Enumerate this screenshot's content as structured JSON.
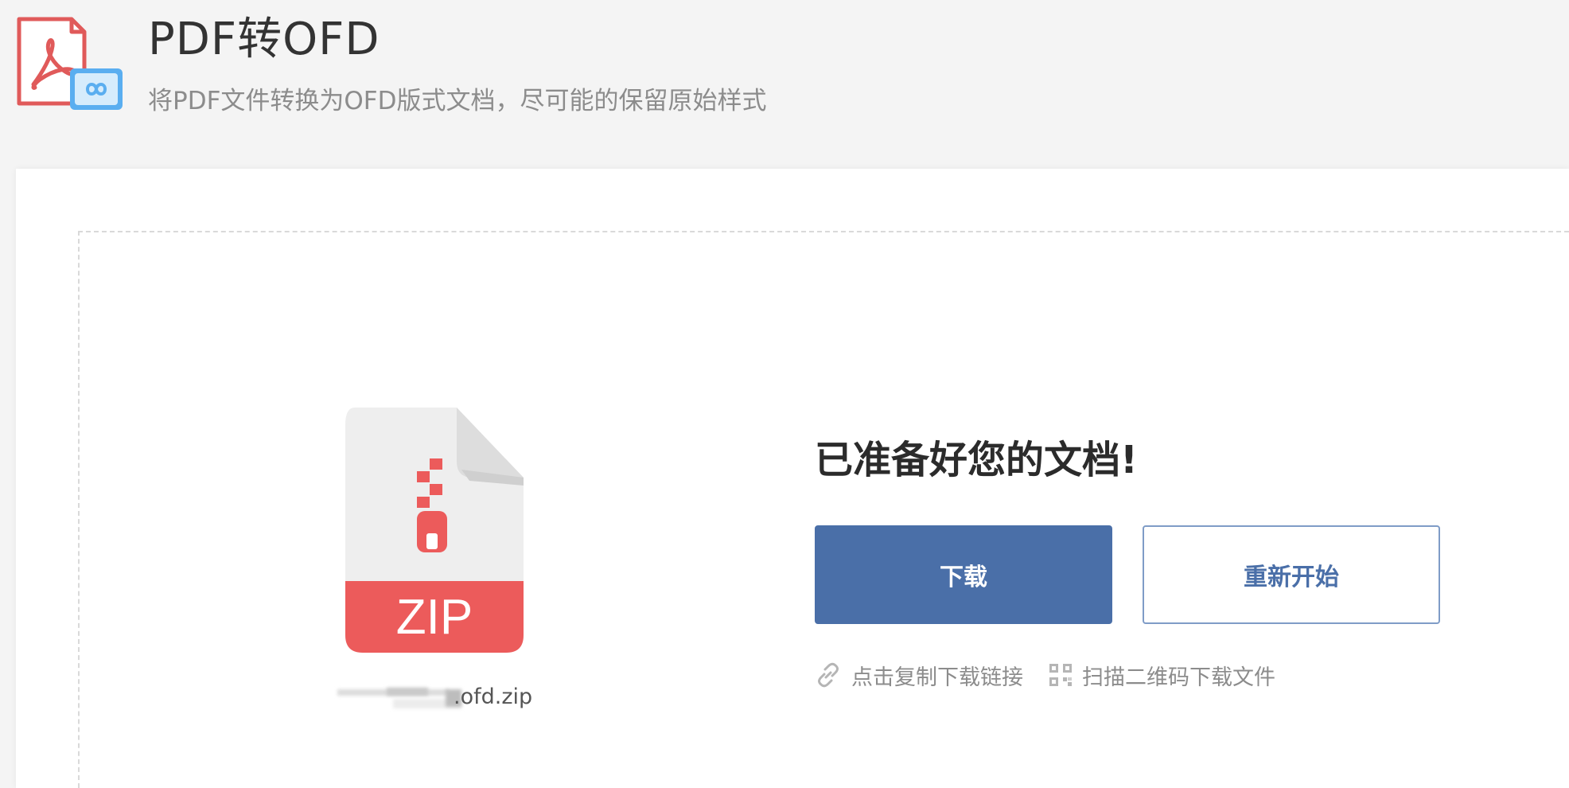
{
  "header": {
    "title": "PDF转OFD",
    "subtitle": "将PDF文件转换为OFD版式文档，尽可能的保留原始样式"
  },
  "logo": {
    "icon": "pdf-to-ofd-logo-icon",
    "colors": {
      "pdf_red": "#e05a5a",
      "ofd_blue": "#5aaef0"
    }
  },
  "file": {
    "icon": "zip-file-icon",
    "badge_text": "ZIP",
    "name_visible": ".ofd.zip",
    "name_prefix_obscured": true,
    "colors": {
      "badge": "#ec5b5b",
      "sheet": "#eeeeee",
      "fold": "#dddddd"
    }
  },
  "result": {
    "heading": "已准备好您的文档!",
    "download_label": "下载",
    "restart_label": "重新开始",
    "copy_link_label": "点击复制下载链接",
    "copy_link_icon": "link-icon",
    "qr_label": "扫描二维码下载文件",
    "qr_icon": "qr-code-icon"
  },
  "colors": {
    "primary": "#4a6fa8",
    "primary_border_light": "#7f9cc7",
    "muted_text": "#8c8c8c",
    "heading_text": "#2b2b2b",
    "background": "#f4f4f4",
    "card": "#ffffff"
  }
}
